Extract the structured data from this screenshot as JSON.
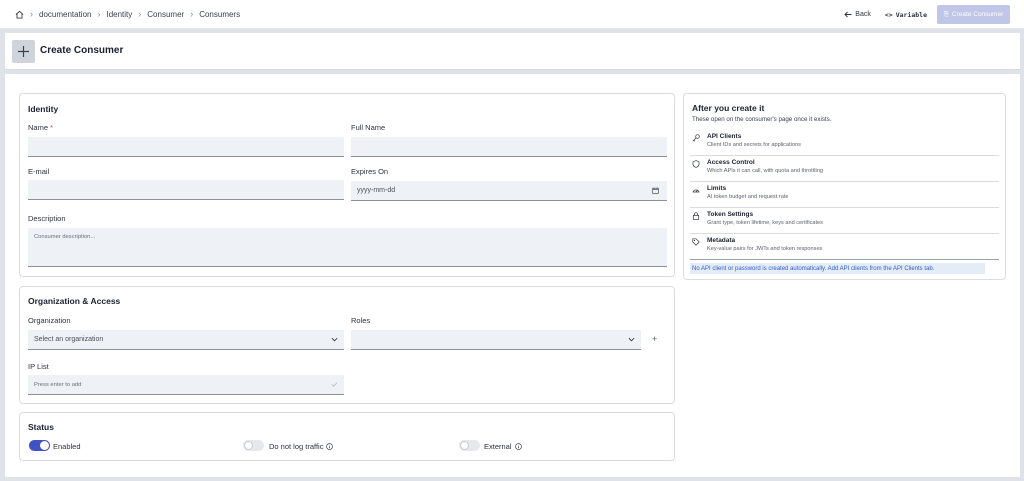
{
  "breadcrumb": {
    "items": [
      "documentation",
      "Identity",
      "Consumer",
      "Consumers"
    ]
  },
  "topActions": {
    "back": "Back",
    "variable": "Variable",
    "create": "Create Consumer"
  },
  "header": {
    "title": "Create Consumer"
  },
  "identity": {
    "title": "Identity",
    "name_label": "Name",
    "name_required": "*",
    "fullname_label": "Full Name",
    "email_label": "E-mail",
    "expires_label": "Expires On",
    "expires_placeholder": "yyyy-mm-dd",
    "description_label": "Description",
    "description_placeholder": "Consumer description..."
  },
  "org": {
    "title": "Organization & Access",
    "org_label": "Organization",
    "org_value": "Select an organization",
    "roles_label": "Roles",
    "ip_label": "IP List",
    "ip_placeholder": "Press enter to add"
  },
  "status": {
    "title": "Status",
    "enabled": "Enabled",
    "enabled_on": true,
    "nolog": "Do not log traffic",
    "nolog_on": false,
    "external": "External",
    "external_on": false
  },
  "side": {
    "title": "After you create it",
    "subtitle": "These open on the consumer's page once it exists.",
    "items": [
      {
        "icon": "key-icon",
        "title": "API Clients",
        "desc": "Client IDs and secrets for applications"
      },
      {
        "icon": "shield-icon",
        "title": "Access Control",
        "desc": "Which APIs it can call, with quota and throttling"
      },
      {
        "icon": "gauge-icon",
        "title": "Limits",
        "desc": "AI token budget and request rate"
      },
      {
        "icon": "lock-icon",
        "title": "Token Settings",
        "desc": "Grant type, token lifetime, keys and certificates"
      },
      {
        "icon": "tag-icon",
        "title": "Metadata",
        "desc": "Key-value pairs for JWTs and token responses"
      }
    ],
    "note": "No API client or password is created automatically. Add API clients from the API Clients tab."
  },
  "colors": {
    "accent": "#4152c5",
    "note_bg": "#e4ecf8",
    "note_text": "#2f5bd0"
  }
}
